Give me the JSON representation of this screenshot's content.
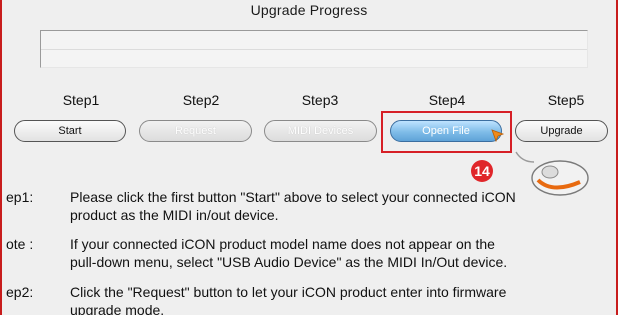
{
  "dialog": {
    "title": "Upgrade Progress"
  },
  "steps": [
    {
      "label": "Step1",
      "button": "Start",
      "state": "enabled"
    },
    {
      "label": "Step2",
      "button": "Request",
      "state": "disabled"
    },
    {
      "label": "Step3",
      "button": "MIDI Devices",
      "state": "disabled"
    },
    {
      "label": "Step4",
      "button": "Open File",
      "state": "active"
    },
    {
      "label": "Step5",
      "button": "Upgrade",
      "state": "enabled"
    }
  ],
  "callout": {
    "number": "14",
    "color": "#e0262a"
  },
  "instructions": [
    {
      "label": "ep1:",
      "lines": [
        "Please click the first button \"Start\" above to select your connected iCON",
        "product as the MIDI in/out device."
      ]
    },
    {
      "label": "ote :",
      "lines": [
        "If your connected iCON product model name does not appear on the",
        "pull-down menu, select \"USB Audio Device\" as the MIDI In/Out device."
      ]
    },
    {
      "label": "ep2:",
      "lines": [
        "Click the \"Request\" button to let your iCON product enter into firmware",
        "upgrade mode."
      ]
    }
  ]
}
